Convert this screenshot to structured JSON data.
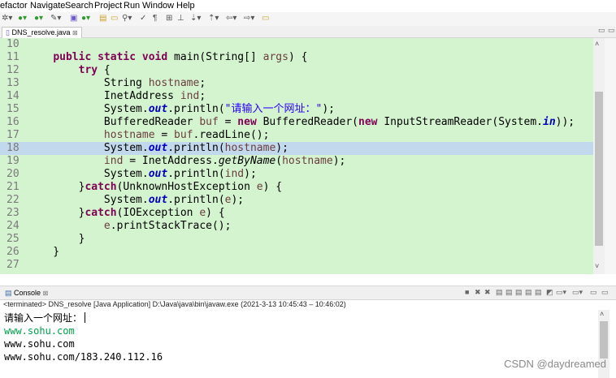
{
  "menu": {
    "refactor": "efactor",
    "navigate": "Navigate",
    "search": "Search",
    "project": "Project",
    "run": "Run",
    "window": "Window",
    "help": "Help"
  },
  "editor": {
    "tab_label": "DNS_resolve.java",
    "tab_close": "⊠"
  },
  "code_lines": [
    {
      "n": "10",
      "text": ""
    },
    {
      "n": "11",
      "text": "    public static void main(String[] args) {"
    },
    {
      "n": "12",
      "text": "        try {"
    },
    {
      "n": "13",
      "text": "            String hostname;"
    },
    {
      "n": "14",
      "text": "            InetAddress ind;"
    },
    {
      "n": "15",
      "text": "            System.out.println(\"请输入一个网址：\");"
    },
    {
      "n": "16",
      "text": "            BufferedReader buf = new BufferedReader(new InputStreamReader(System.in));"
    },
    {
      "n": "17",
      "text": "            hostname = buf.readLine();"
    },
    {
      "n": "18",
      "text": "            System.out.println(hostname);"
    },
    {
      "n": "19",
      "text": "            ind = InetAddress.getByName(hostname);"
    },
    {
      "n": "20",
      "text": "            System.out.println(ind);"
    },
    {
      "n": "21",
      "text": "        }catch(UnknownHostException e) {"
    },
    {
      "n": "22",
      "text": "            System.out.println(e);"
    },
    {
      "n": "23",
      "text": "        }catch(IOException e) {"
    },
    {
      "n": "24",
      "text": "            e.printStackTrace();"
    },
    {
      "n": "25",
      "text": "        }"
    },
    {
      "n": "26",
      "text": "    }"
    },
    {
      "n": "27",
      "text": ""
    }
  ],
  "console": {
    "tab_label": "Console",
    "tab_close": "⊠",
    "status": "<terminated> DNS_resolve [Java Application] D:\\Java\\java\\bin\\javaw.exe  (2021-3-13 10:45:43 – 10:46:02)",
    "lines": [
      "请输入一个网址：",
      "www.sohu.com",
      "www.sohu.com",
      "www.sohu.com/183.240.112.16"
    ]
  },
  "watermark": "CSDN @daydreamed",
  "colors": {
    "editor_bg": "#d4f3cf",
    "current_line": "#c2d8ec",
    "keyword": "#7f0055",
    "field": "#0000c0",
    "string": "#2a00ff",
    "local_var": "#6a3e3e",
    "console_input": "#00a04a"
  }
}
